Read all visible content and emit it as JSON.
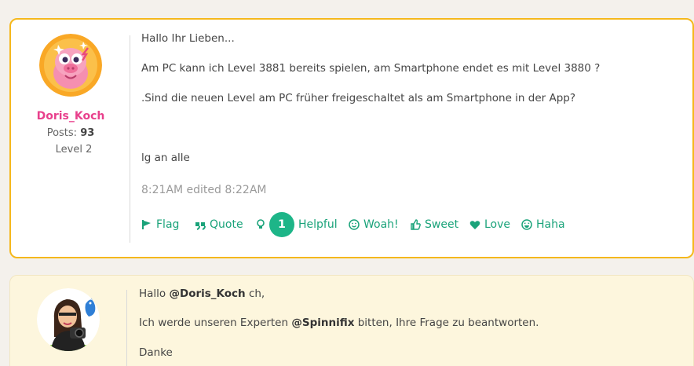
{
  "colors": {
    "accent_green": "#1aa37a",
    "author_pink": "#e8408c",
    "highlight_border": "#f5b81c",
    "reply_bg": "#fdf6dd"
  },
  "post1": {
    "author": {
      "name": "Doris_Koch",
      "posts_label": "Posts:",
      "posts_count": "93",
      "level": "Level 2",
      "avatar_icon": "pig-avatar"
    },
    "lines": [
      "Hallo Ihr Lieben...",
      "Am PC kann ich Level 3881 bereits spielen, am Smartphone endet es mit Level 3880 ?",
      ".Sind die neuen Level am PC früher freigeschaltet als am Smartphone in der App?",
      "lg an alle"
    ],
    "timestamp": "8:21AM edited 8:22AM",
    "actions": {
      "flag": "Flag",
      "quote": "Quote",
      "helpful_count": "1",
      "helpful": "Helpful",
      "woah": "Woah!",
      "sweet": "Sweet",
      "love": "Love",
      "haha": "Haha"
    }
  },
  "post2": {
    "author": {
      "avatar_icon": "bitmoji-avatar"
    },
    "greeting_pre": "Hallo",
    "greeting_mention": "@Doris_Koch",
    "greeting_post": "ch,",
    "line2_pre": "Ich werde unseren Experten",
    "line2_mention": "@Spinnifix",
    "line2_post": "bitten, Ihre Frage zu beantworten.",
    "line3": "Danke"
  }
}
